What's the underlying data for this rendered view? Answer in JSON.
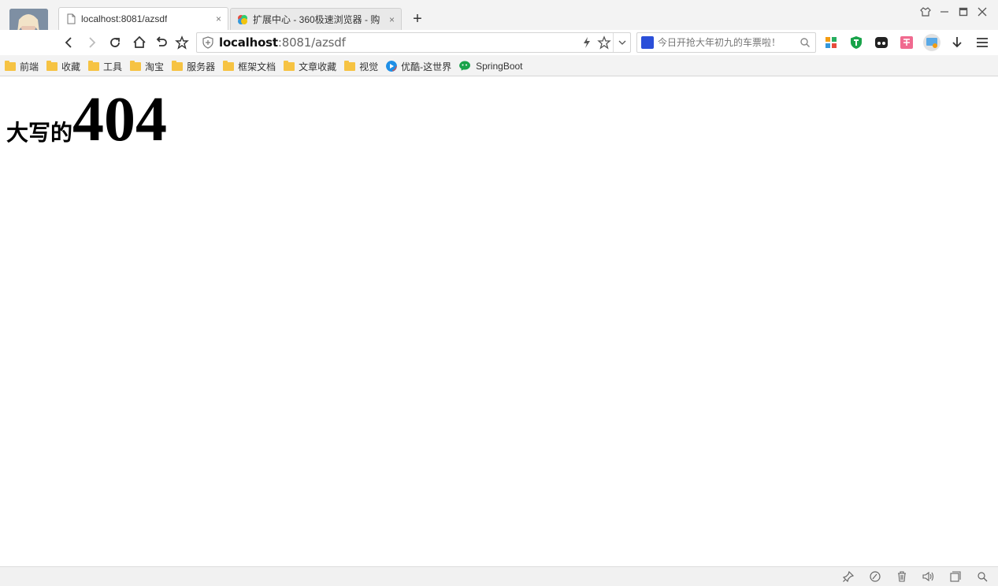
{
  "tabs": [
    {
      "title": "localhost:8081/azsdf",
      "close": "×",
      "active": true
    },
    {
      "title": "扩展中心 - 360极速浏览器 - 购",
      "close": "×",
      "active": false
    }
  ],
  "new_tab_label": "+",
  "address": {
    "host": "localhost",
    "path": ":8081/azsdf"
  },
  "search": {
    "placeholder": "今日开抢大年初九的车票啦！"
  },
  "bookmarks": [
    {
      "label": "前端",
      "icon": "folder-icon"
    },
    {
      "label": "收藏",
      "icon": "folder-icon"
    },
    {
      "label": "工具",
      "icon": "folder-icon"
    },
    {
      "label": "淘宝",
      "icon": "folder-icon"
    },
    {
      "label": "服务器",
      "icon": "folder-icon"
    },
    {
      "label": "框架文档",
      "icon": "folder-icon"
    },
    {
      "label": "文章收藏",
      "icon": "folder-icon"
    },
    {
      "label": "视觉",
      "icon": "folder-icon"
    },
    {
      "label": "优酷-这世界",
      "icon": "youku-icon"
    },
    {
      "label": "SpringBoot",
      "icon": "wechat-icon"
    }
  ],
  "page": {
    "prefix": "大写的",
    "code": "404"
  },
  "colors": {
    "folder": "#f6c343",
    "accent_green": "#19a34a",
    "engine_blue": "#2b4fd9"
  }
}
